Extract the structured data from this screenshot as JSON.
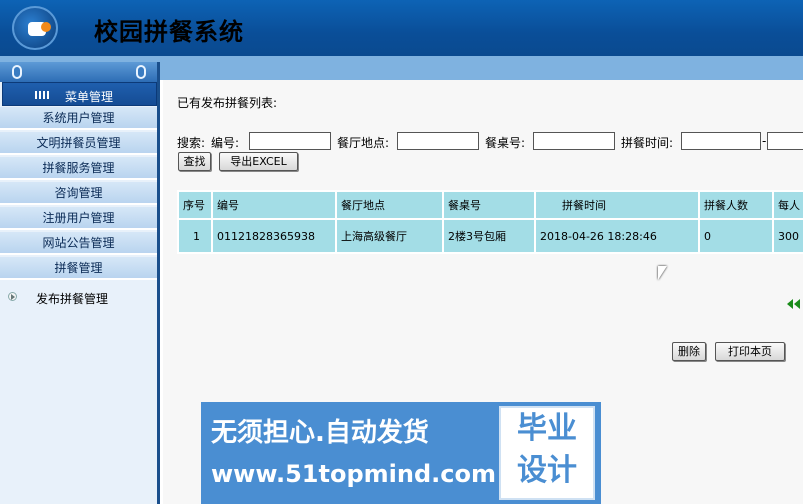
{
  "app": {
    "title": "校园拼餐系统"
  },
  "sidebar": {
    "menu_header": "菜单管理",
    "items": [
      {
        "label": "系统用户管理"
      },
      {
        "label": "文明拼餐员管理"
      },
      {
        "label": "拼餐服务管理"
      },
      {
        "label": "咨询管理"
      },
      {
        "label": "注册用户管理"
      },
      {
        "label": "网站公告管理"
      },
      {
        "label": "拼餐管理"
      }
    ],
    "sub_item": "发布拼餐管理"
  },
  "main": {
    "list_title": "已有发布拼餐列表:",
    "search": {
      "label": "搜索:",
      "field_code": "编号:",
      "field_place": "餐厅地点:",
      "field_table": "餐桌号:",
      "field_time": "拼餐时间:",
      "time_sep": "-"
    },
    "buttons": {
      "search": "查找",
      "export": "导出EXCEL",
      "delete": "删除",
      "print": "打印本页"
    },
    "table": {
      "columns": [
        "序号",
        "编号",
        "餐厅地点",
        "餐桌号",
        "拼餐时间",
        "拼餐人数",
        "每人"
      ],
      "rows": [
        [
          "1",
          "01121828365938",
          "上海高级餐厅",
          "2楼3号包厢",
          "2018-04-26 18:28:46",
          "0",
          "300"
        ]
      ]
    }
  },
  "watermark": {
    "line1": "无须担心.自动发货",
    "line2": "www.51topmind.com",
    "box_line1": "毕业",
    "box_line2": "设计"
  }
}
